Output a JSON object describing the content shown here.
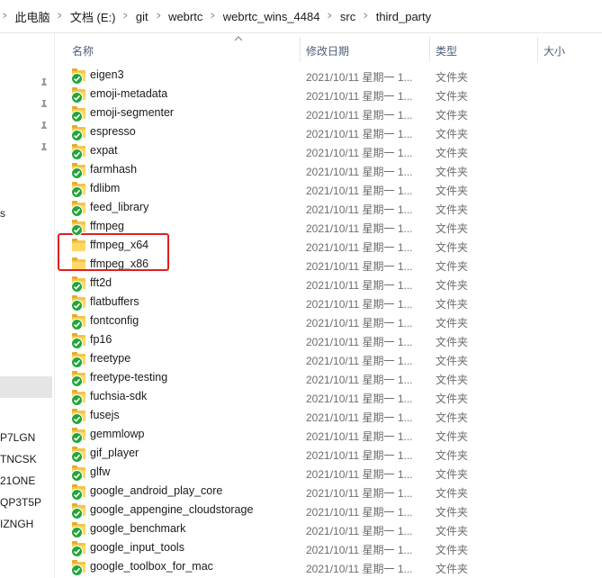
{
  "breadcrumb": [
    "此电脑",
    "文档 (E:)",
    "git",
    "webrtc",
    "webrtc_wins_4484",
    "src",
    "third_party"
  ],
  "columns": {
    "name": "名称",
    "date": "修改日期",
    "type": "类型",
    "size": "大小"
  },
  "nav_labels": [
    "s",
    "P7LGN",
    "TNCSK",
    "21ONE",
    "QP3T5P",
    "IZNGH"
  ],
  "rows": [
    {
      "name": "eigen3",
      "date": "2021/10/11 星期一 1...",
      "type": "文件夹",
      "synced": true
    },
    {
      "name": "emoji-metadata",
      "date": "2021/10/11 星期一 1...",
      "type": "文件夹",
      "synced": true
    },
    {
      "name": "emoji-segmenter",
      "date": "2021/10/11 星期一 1...",
      "type": "文件夹",
      "synced": true
    },
    {
      "name": "espresso",
      "date": "2021/10/11 星期一 1...",
      "type": "文件夹",
      "synced": true
    },
    {
      "name": "expat",
      "date": "2021/10/11 星期一 1...",
      "type": "文件夹",
      "synced": true
    },
    {
      "name": "farmhash",
      "date": "2021/10/11 星期一 1...",
      "type": "文件夹",
      "synced": true
    },
    {
      "name": "fdlibm",
      "date": "2021/10/11 星期一 1...",
      "type": "文件夹",
      "synced": true
    },
    {
      "name": "feed_library",
      "date": "2021/10/11 星期一 1...",
      "type": "文件夹",
      "synced": true
    },
    {
      "name": "ffmpeg",
      "date": "2021/10/11 星期一 1...",
      "type": "文件夹",
      "synced": true
    },
    {
      "name": "ffmpeg_x64",
      "date": "2021/10/11 星期一 1...",
      "type": "文件夹",
      "synced": false
    },
    {
      "name": "ffmpeg_x86",
      "date": "2021/10/11 星期一 1...",
      "type": "文件夹",
      "synced": false
    },
    {
      "name": "fft2d",
      "date": "2021/10/11 星期一 1...",
      "type": "文件夹",
      "synced": true
    },
    {
      "name": "flatbuffers",
      "date": "2021/10/11 星期一 1...",
      "type": "文件夹",
      "synced": true
    },
    {
      "name": "fontconfig",
      "date": "2021/10/11 星期一 1...",
      "type": "文件夹",
      "synced": true
    },
    {
      "name": "fp16",
      "date": "2021/10/11 星期一 1...",
      "type": "文件夹",
      "synced": true
    },
    {
      "name": "freetype",
      "date": "2021/10/11 星期一 1...",
      "type": "文件夹",
      "synced": true
    },
    {
      "name": "freetype-testing",
      "date": "2021/10/11 星期一 1...",
      "type": "文件夹",
      "synced": true
    },
    {
      "name": "fuchsia-sdk",
      "date": "2021/10/11 星期一 1...",
      "type": "文件夹",
      "synced": true
    },
    {
      "name": "fusejs",
      "date": "2021/10/11 星期一 1...",
      "type": "文件夹",
      "synced": true
    },
    {
      "name": "gemmlowp",
      "date": "2021/10/11 星期一 1...",
      "type": "文件夹",
      "synced": true
    },
    {
      "name": "gif_player",
      "date": "2021/10/11 星期一 1...",
      "type": "文件夹",
      "synced": true
    },
    {
      "name": "glfw",
      "date": "2021/10/11 星期一 1...",
      "type": "文件夹",
      "synced": true
    },
    {
      "name": "google_android_play_core",
      "date": "2021/10/11 星期一 1...",
      "type": "文件夹",
      "synced": true
    },
    {
      "name": "google_appengine_cloudstorage",
      "date": "2021/10/11 星期一 1...",
      "type": "文件夹",
      "synced": true
    },
    {
      "name": "google_benchmark",
      "date": "2021/10/11 星期一 1...",
      "type": "文件夹",
      "synced": true
    },
    {
      "name": "google_input_tools",
      "date": "2021/10/11 星期一 1...",
      "type": "文件夹",
      "synced": true
    },
    {
      "name": "google_toolbox_for_mac",
      "date": "2021/10/11 星期一 1...",
      "type": "文件夹",
      "synced": true
    }
  ],
  "colors": {
    "highlight_border": "#e02020",
    "sync_badge": "#22a63a",
    "folder": "#ffd867",
    "header_text": "#4c607a"
  }
}
